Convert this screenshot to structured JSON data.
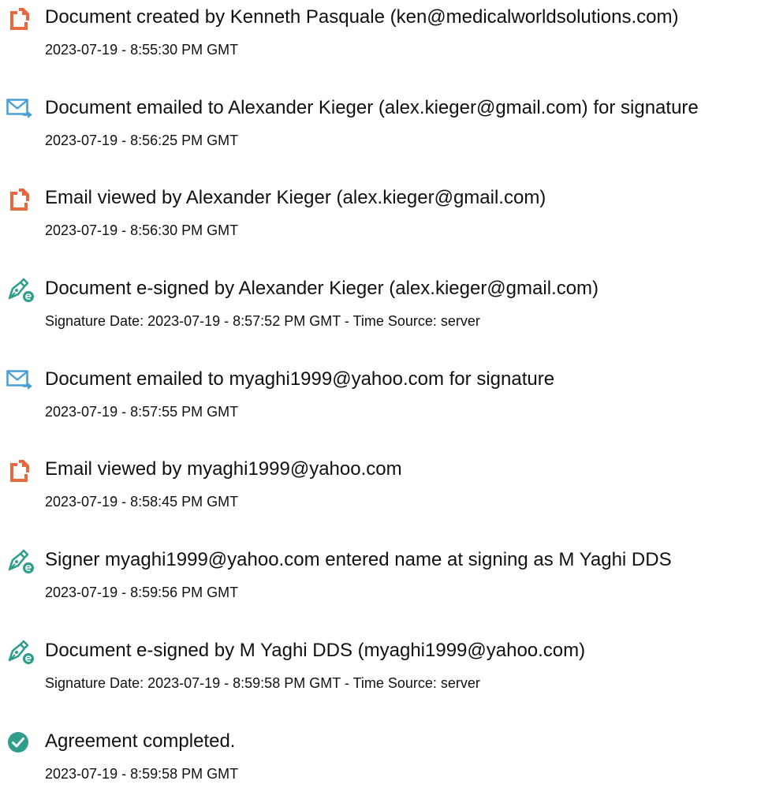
{
  "colors": {
    "document_icon": "#e8683f",
    "email_icon": "#4a9fd8",
    "signature_icon": "#2e9d8c",
    "complete_icon": "#2e9d8c"
  },
  "events": [
    {
      "icon": "document-icon",
      "title": "Document created by Kenneth Pasquale (ken@medicalworldsolutions.com)",
      "detail": "2023-07-19 - 8:55:30 PM GMT"
    },
    {
      "icon": "email-sent-icon",
      "title": "Document emailed to Alexander Kieger (alex.kieger@gmail.com) for signature",
      "detail": "2023-07-19 - 8:56:25 PM GMT"
    },
    {
      "icon": "document-icon",
      "title": "Email viewed by Alexander Kieger (alex.kieger@gmail.com)",
      "detail": "2023-07-19 - 8:56:30 PM GMT"
    },
    {
      "icon": "e-signature-icon",
      "title": "Document e-signed by Alexander Kieger (alex.kieger@gmail.com)",
      "detail": "Signature Date: 2023-07-19 - 8:57:52 PM GMT - Time Source: server"
    },
    {
      "icon": "email-sent-icon",
      "title": "Document emailed to myaghi1999@yahoo.com for signature",
      "detail": "2023-07-19 - 8:57:55 PM GMT"
    },
    {
      "icon": "document-icon",
      "title": "Email viewed by myaghi1999@yahoo.com",
      "detail": "2023-07-19 - 8:58:45 PM GMT"
    },
    {
      "icon": "e-signature-icon",
      "title": "Signer myaghi1999@yahoo.com entered name at signing as M Yaghi DDS",
      "detail": "2023-07-19 - 8:59:56 PM GMT"
    },
    {
      "icon": "e-signature-icon",
      "title": "Document e-signed by M Yaghi DDS (myaghi1999@yahoo.com)",
      "detail": "Signature Date: 2023-07-19 - 8:59:58 PM GMT - Time Source: server"
    },
    {
      "icon": "check-circle-icon",
      "title": "Agreement completed.",
      "detail": "2023-07-19 - 8:59:58 PM GMT"
    }
  ]
}
